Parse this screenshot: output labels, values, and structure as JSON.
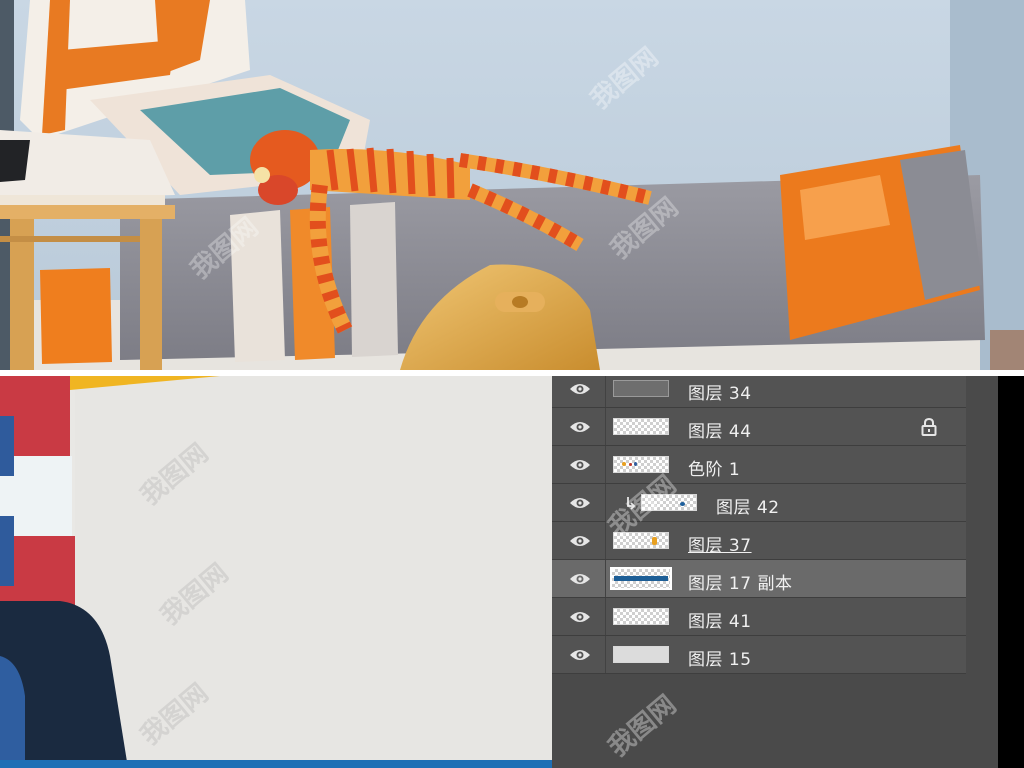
{
  "layers_panel": {
    "layers": [
      {
        "name": "图层 34",
        "thumbnail": "gray-texture",
        "visible": true,
        "locked": false,
        "clipped": false,
        "selected": false,
        "underlined": false
      },
      {
        "name": "图层 44",
        "thumbnail": "transparent",
        "visible": true,
        "locked": true,
        "clipped": false,
        "selected": false,
        "underlined": false
      },
      {
        "name": "色阶 1",
        "thumbnail": "transparent-with-dots",
        "visible": true,
        "locked": false,
        "clipped": false,
        "selected": false,
        "underlined": false
      },
      {
        "name": "图层 42",
        "thumbnail": "transparent-with-blue-dot",
        "visible": true,
        "locked": false,
        "clipped": true,
        "selected": false,
        "underlined": false
      },
      {
        "name": "图层 37",
        "thumbnail": "transparent-with-orange-dot",
        "visible": true,
        "locked": false,
        "clipped": false,
        "selected": false,
        "underlined": true
      },
      {
        "name": "图层 17 副本",
        "thumbnail": "blue-stripe",
        "visible": true,
        "locked": false,
        "clipped": false,
        "selected": true,
        "underlined": false
      },
      {
        "name": "图层 41",
        "thumbnail": "transparent",
        "visible": true,
        "locked": false,
        "clipped": false,
        "selected": false,
        "underlined": false
      },
      {
        "name": "图层 15",
        "thumbnail": "light-gray-fill",
        "visible": true,
        "locked": false,
        "clipped": false,
        "selected": false,
        "underlined": false
      }
    ],
    "icons": {
      "visibility": "eye-icon",
      "lock": "lock-icon",
      "clip": "clipping-arrow-icon"
    }
  },
  "colors": {
    "panel_bg": "#4a4a4a",
    "row_bg": "#535353",
    "selected_row_bg": "#6a6a6a",
    "text": "#f0f0f0"
  }
}
